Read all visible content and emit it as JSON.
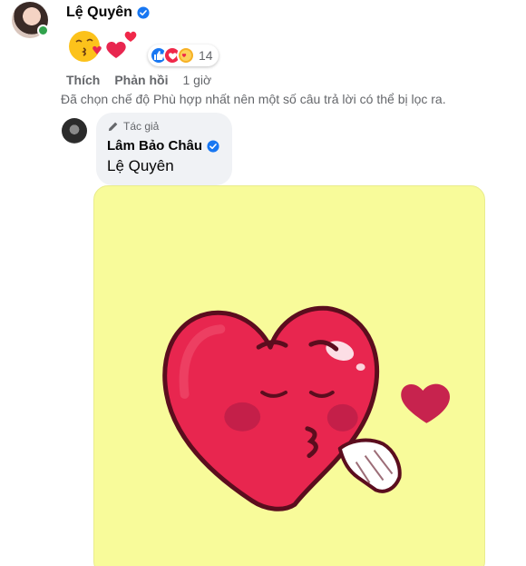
{
  "comment": {
    "author": "Lệ Quyên",
    "verified_icon": "verified-badge-icon",
    "content_icons": [
      "kissing-heart-emoji-icon",
      "red-heart-icon"
    ],
    "reactions": {
      "icons": [
        "like-icon",
        "love-icon",
        "care-icon"
      ],
      "count": "14"
    },
    "actions": {
      "like": "Thích",
      "reply": "Phản hồi",
      "time": "1 giờ"
    },
    "filter_note": "Đã chọn chế độ Phù hợp nhất nên một số câu trả lời có thể bị lọc ra."
  },
  "reply": {
    "badge": "Tác giả",
    "badge_icon": "pencil-icon",
    "author": "Lâm Bảo Châu",
    "text": "Lệ Quyên",
    "sticker": "blowing-kiss-heart-sticker"
  },
  "colors": {
    "verified": "#1877f2",
    "sticker_bg": "#f8fb9a",
    "heart": "#e8264f",
    "online": "#31a24c"
  }
}
